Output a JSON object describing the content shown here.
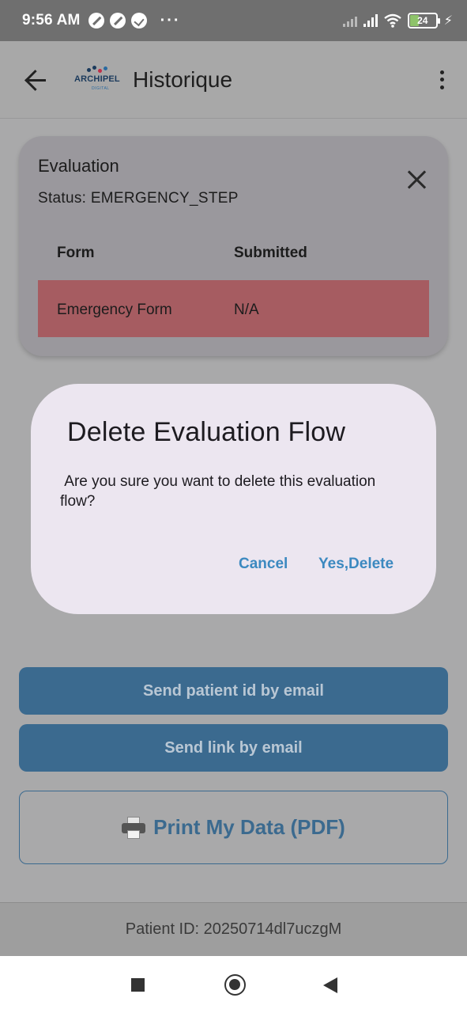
{
  "status_bar": {
    "time": "9:56 AM",
    "more": "···",
    "battery": "24"
  },
  "app_bar": {
    "logo_text": "ARCHIPEL",
    "logo_sub": "DIGITAL",
    "title": "Historique"
  },
  "evaluation_card": {
    "title": "Evaluation",
    "status": "Status: EMERGENCY_STEP",
    "columns": [
      "Form",
      "Submitted"
    ],
    "rows": [
      {
        "form": "Emergency Form",
        "submitted": "N/A"
      }
    ]
  },
  "dialog": {
    "title": "Delete Evaluation Flow",
    "message": " Are you sure you want to delete this evaluation flow?",
    "cancel_label": "Cancel",
    "confirm_label": "Yes,Delete"
  },
  "actions": {
    "send_patient_id": "Send patient id by email",
    "send_link": "Send link by email",
    "print": "Print My Data (PDF)"
  },
  "footer": {
    "patient_id": "Patient ID: 20250714dl7uczgM"
  },
  "colors": {
    "overlay": "#a9a9aa",
    "row_highlight": "#a65c61",
    "dialog_bg": "#ece6f0",
    "accent": "#3c89c0",
    "button": "#3b6a8f"
  }
}
